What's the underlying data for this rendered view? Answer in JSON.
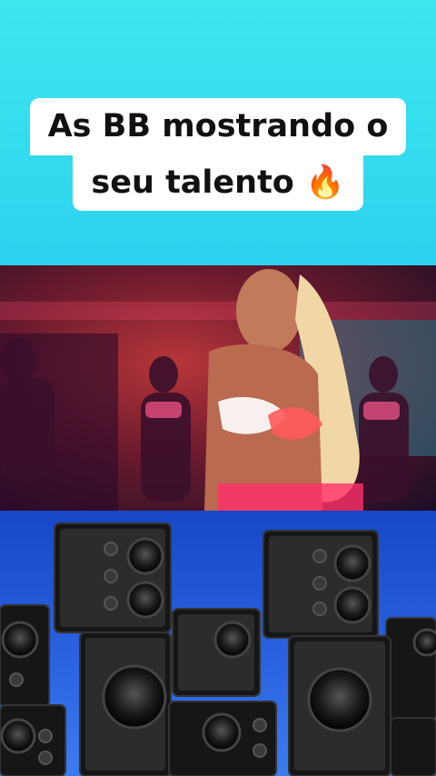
{
  "caption": {
    "line1": "As BB mostrando o",
    "line2": "seu talento 🔥"
  },
  "icons": {
    "fire": "fire-emoji"
  },
  "colors": {
    "background_top": "#3ee6ee",
    "background_bottom": "#1fb3ee",
    "caption_bg": "#ffffff",
    "speakers_bg": "#2a62e0"
  }
}
